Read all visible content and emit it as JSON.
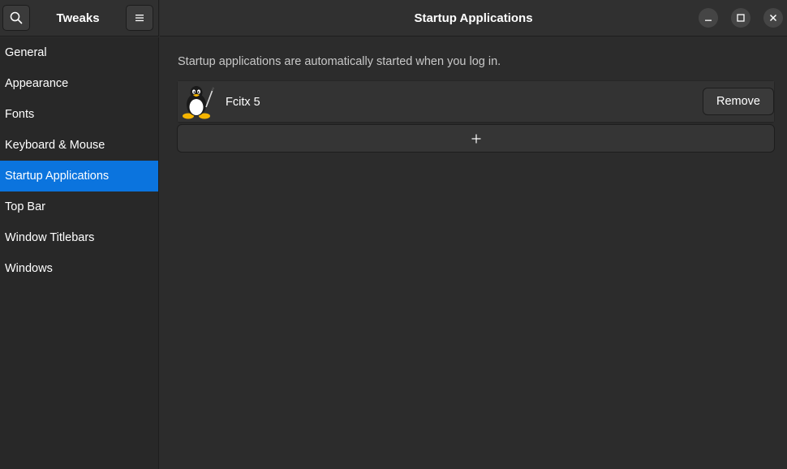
{
  "window": {
    "app_title": "Tweaks",
    "page_title": "Startup Applications"
  },
  "header": {
    "search_icon": "search-icon",
    "menu_icon": "hamburger-menu-icon",
    "window_controls": [
      "minimize-icon",
      "maximize-icon",
      "close-icon"
    ]
  },
  "sidebar": {
    "items": [
      {
        "label": "General"
      },
      {
        "label": "Appearance"
      },
      {
        "label": "Fonts"
      },
      {
        "label": "Keyboard & Mouse"
      },
      {
        "label": "Startup Applications",
        "selected": true
      },
      {
        "label": "Top Bar"
      },
      {
        "label": "Window Titlebars"
      },
      {
        "label": "Windows"
      }
    ]
  },
  "main": {
    "description": "Startup applications are automatically started when you log in.",
    "apps": [
      {
        "name": "Fcitx 5",
        "icon": "tux-penguin-icon",
        "remove_label": "Remove"
      }
    ],
    "add_button_icon": "plus-icon"
  },
  "colors": {
    "accent": "#0b74de",
    "background": "#2c2c2c",
    "sidebar": "#282828",
    "header": "#303030"
  }
}
